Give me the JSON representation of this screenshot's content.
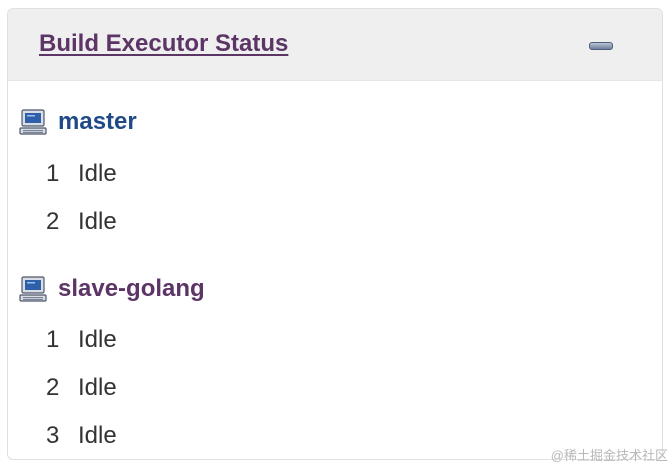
{
  "panel": {
    "title": "Build Executor Status",
    "collapse_icon": "minimize-icon"
  },
  "computers": [
    {
      "name": "master",
      "icon": "computer-icon",
      "executors": [
        {
          "number": "1",
          "status": "Idle"
        },
        {
          "number": "2",
          "status": "Idle"
        }
      ]
    },
    {
      "name": "slave-golang",
      "icon": "computer-icon",
      "executors": [
        {
          "number": "1",
          "status": "Idle"
        },
        {
          "number": "2",
          "status": "Idle"
        },
        {
          "number": "3",
          "status": "Idle"
        }
      ]
    }
  ],
  "watermark": "@稀土掘金技术社区",
  "colors": {
    "header_bg": "#efefef",
    "title": "#5c3566",
    "master_link": "#204a87",
    "slave_link": "#5c3566",
    "text": "#333333"
  }
}
